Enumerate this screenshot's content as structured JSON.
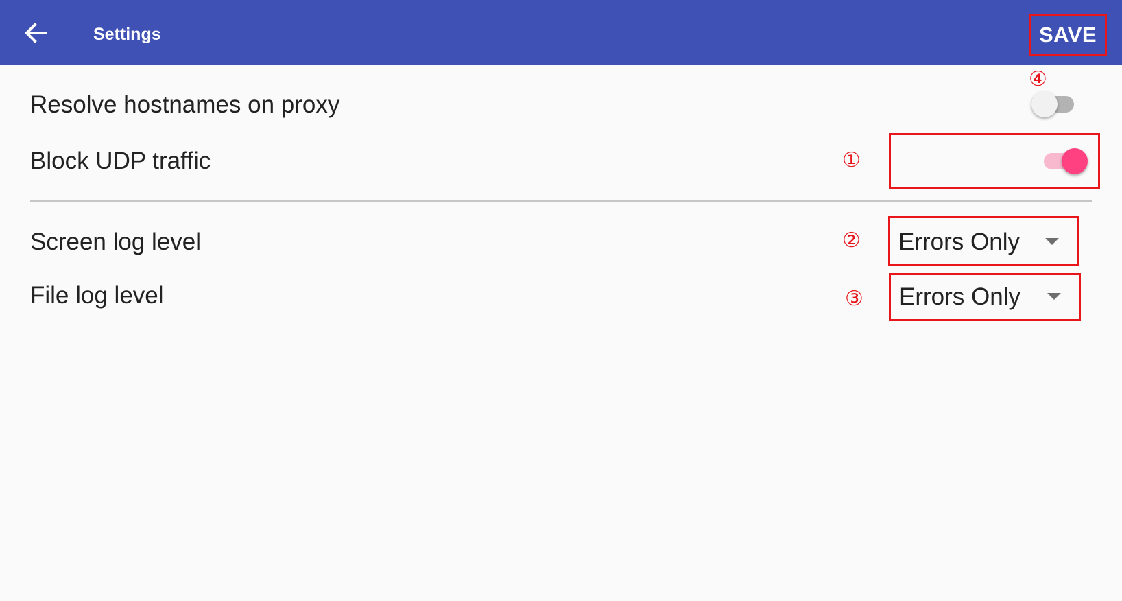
{
  "appbar": {
    "title": "Settings",
    "back_icon": "arrow-back-icon",
    "save_label": "SAVE",
    "color": "#3f51b5"
  },
  "settings": {
    "resolve_hostnames": {
      "label": "Resolve hostnames on proxy",
      "enabled": false
    },
    "block_udp": {
      "label": "Block UDP traffic",
      "enabled": true
    },
    "screen_log_level": {
      "label": "Screen log level",
      "value": "Errors Only"
    },
    "file_log_level": {
      "label": "File log level",
      "value": "Errors Only"
    }
  },
  "annotations": {
    "m1": "①",
    "m2": "②",
    "m3": "③",
    "m4": "④",
    "color": "#e8151b"
  },
  "accent_color": "#ff4081"
}
